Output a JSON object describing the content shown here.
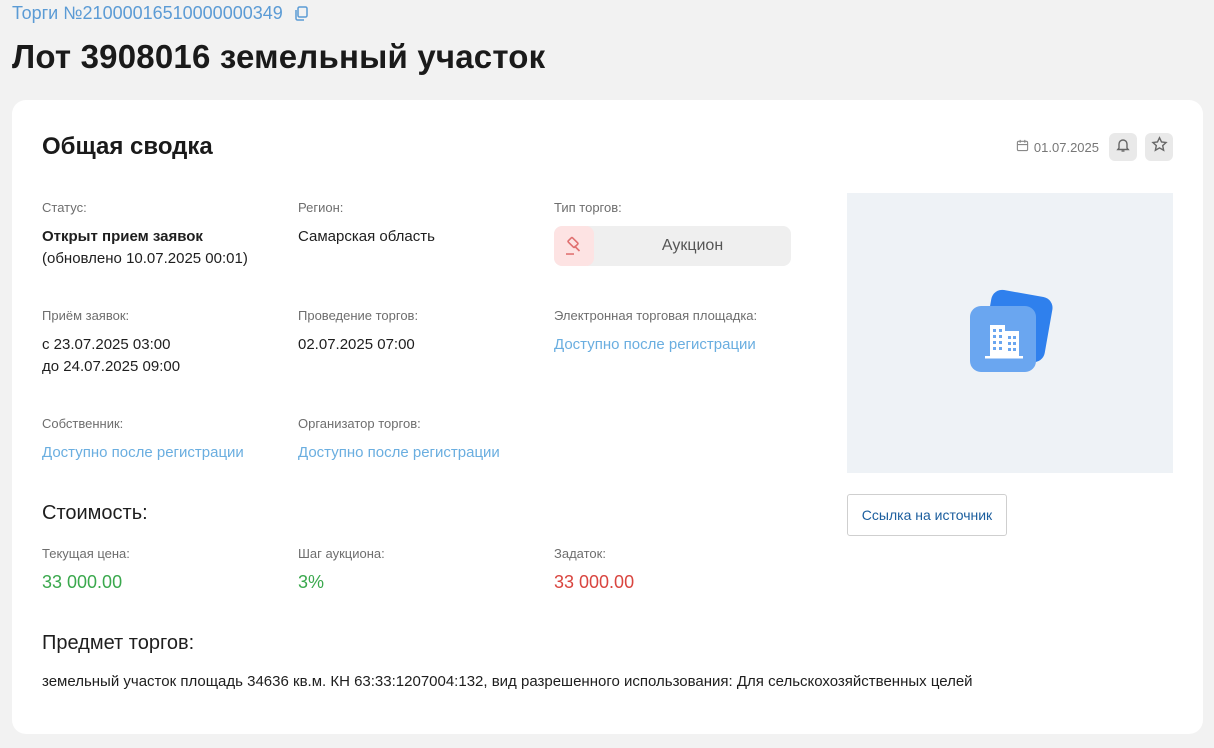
{
  "breadcrumb": {
    "label": "Торги №21000016510000000349"
  },
  "page": {
    "title": "Лот 3908016 земельный участок"
  },
  "summary": {
    "title": "Общая сводка",
    "date": "01.07.2025",
    "status": {
      "label": "Статус:",
      "value": "Открыт прием заявок",
      "updated": "(обновлено 10.07.2025 00:01)"
    },
    "region": {
      "label": "Регион:",
      "value": "Самарская область"
    },
    "auction_type": {
      "label": "Тип торгов:",
      "value": "Аукцион"
    },
    "applications": {
      "label": "Приём заявок:",
      "from": "с 23.07.2025 03:00",
      "to": "до 24.07.2025 09:00"
    },
    "auction_date": {
      "label": "Проведение торгов:",
      "value": "02.07.2025 07:00"
    },
    "platform": {
      "label": "Электронная торговая площадка:",
      "value": "Доступно после регистрации"
    },
    "owner": {
      "label": "Собственник:",
      "value": "Доступно после регистрации"
    },
    "organizer": {
      "label": "Организатор торгов:",
      "value": "Доступно после регистрации"
    },
    "source_button": "Ссылка на источник"
  },
  "cost": {
    "title": "Стоимость:",
    "current": {
      "label": "Текущая цена:",
      "value": "33 000.00"
    },
    "step": {
      "label": "Шаг аукциона:",
      "value": "3%"
    },
    "deposit": {
      "label": "Задаток:",
      "value": "33 000.00"
    }
  },
  "subject": {
    "title": "Предмет торгов:",
    "text": "земельный участок площадь 34636 кв.м. КН 63:33:1207004:132, вид разрешенного использования: Для сельскохозяйственных целей"
  },
  "colors": {
    "link": "#6aaee0",
    "price_green": "#3aa84d",
    "price_red": "#d9453f",
    "accent_blue": "#1b5e9e"
  }
}
